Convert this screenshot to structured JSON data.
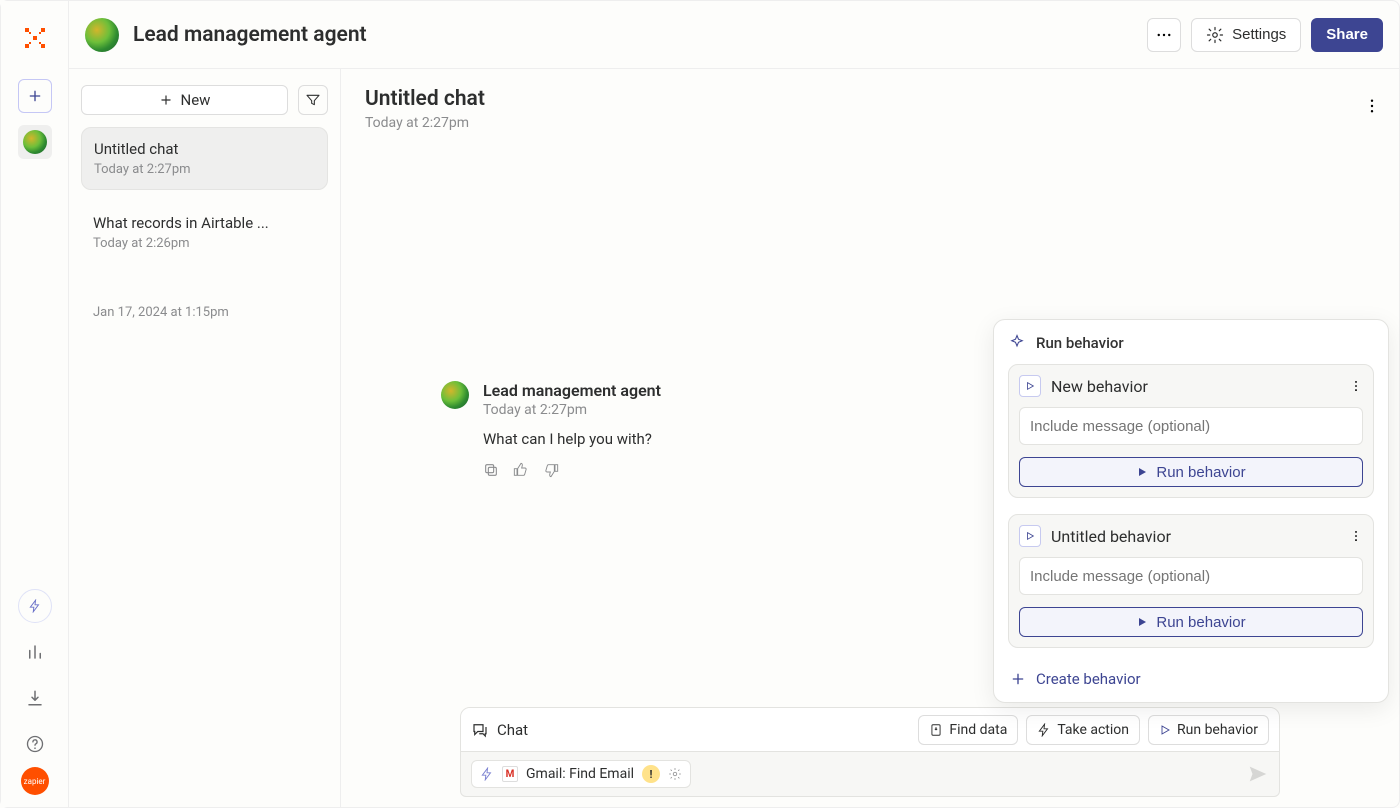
{
  "header": {
    "app_title": "Lead management agent",
    "settings_label": "Settings",
    "share_label": "Share"
  },
  "sidebar": {
    "new_label": "New"
  },
  "chats": [
    {
      "title": "Untitled chat",
      "time": "Today at 2:27pm",
      "selected": true
    },
    {
      "title": "What records in Airtable ...",
      "time": "Today at 2:26pm",
      "selected": false
    },
    {
      "title": "",
      "time": "Jan 17, 2024 at 1:15pm",
      "selected": false
    }
  ],
  "chat_panel": {
    "title": "Untitled chat",
    "subtitle": "Today at 2:27pm",
    "message": {
      "from": "Lead management agent",
      "time": "Today at 2:27pm",
      "text": "What can I help you with?"
    }
  },
  "composer": {
    "chat_label": "Chat",
    "find_data": "Find data",
    "take_action": "Take action",
    "run_behavior": "Run behavior",
    "tool_label": "Gmail: Find Email"
  },
  "behavior_panel": {
    "title": "Run behavior",
    "cards": [
      {
        "name": "New behavior",
        "placeholder": "Include message (optional)",
        "run_label": "Run behavior"
      },
      {
        "name": "Untitled behavior",
        "placeholder": "Include message (optional)",
        "run_label": "Run behavior"
      }
    ],
    "create_label": "Create behavior"
  }
}
